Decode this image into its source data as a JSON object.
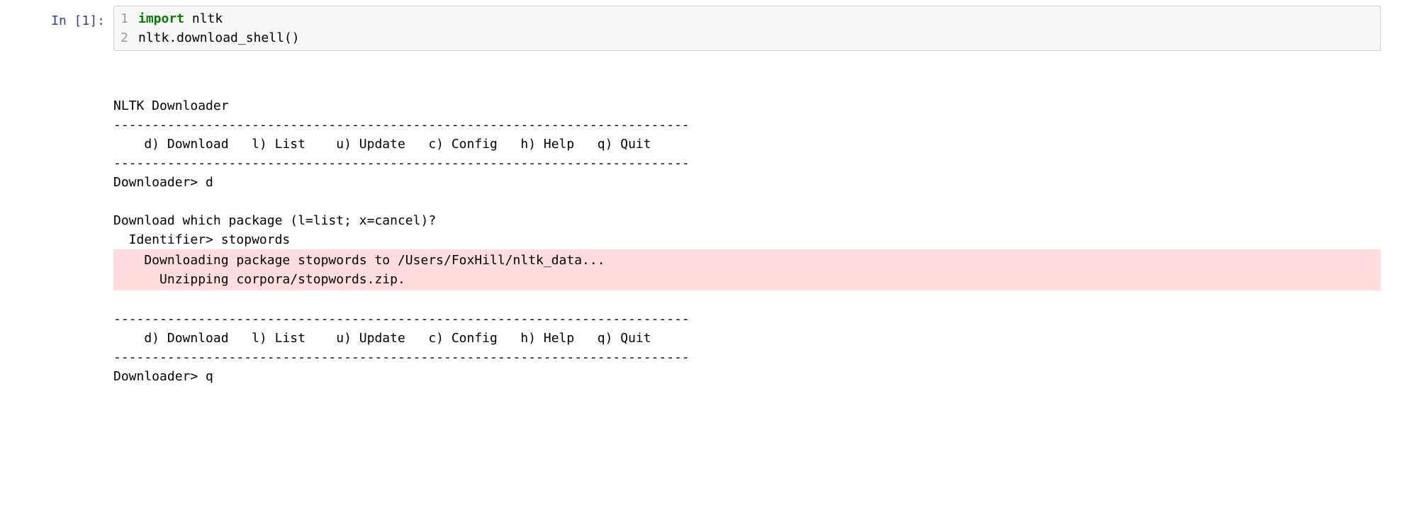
{
  "input": {
    "prompt": "In [1]:",
    "lines": [
      {
        "num": "1",
        "tokens": [
          {
            "text": "import",
            "cls": "kw-import"
          },
          {
            "text": " nltk",
            "cls": "plain"
          }
        ]
      },
      {
        "num": "2",
        "tokens": [
          {
            "text": "nltk.download_shell()",
            "cls": "plain"
          }
        ]
      }
    ]
  },
  "output": {
    "lines_before": [
      "NLTK Downloader",
      "---------------------------------------------------------------------------",
      "    d) Download   l) List    u) Update   c) Config   h) Help   q) Quit",
      "---------------------------------------------------------------------------",
      "Downloader> d",
      "",
      "Download which package (l=list; x=cancel)?",
      "  Identifier> stopwords"
    ],
    "stderr_lines": [
      "    Downloading package stopwords to /Users/FoxHill/nltk_data...",
      "      Unzipping corpora/stopwords.zip."
    ],
    "lines_after": [
      "",
      "---------------------------------------------------------------------------",
      "    d) Download   l) List    u) Update   c) Config   h) Help   q) Quit",
      "---------------------------------------------------------------------------",
      "Downloader> q"
    ]
  }
}
